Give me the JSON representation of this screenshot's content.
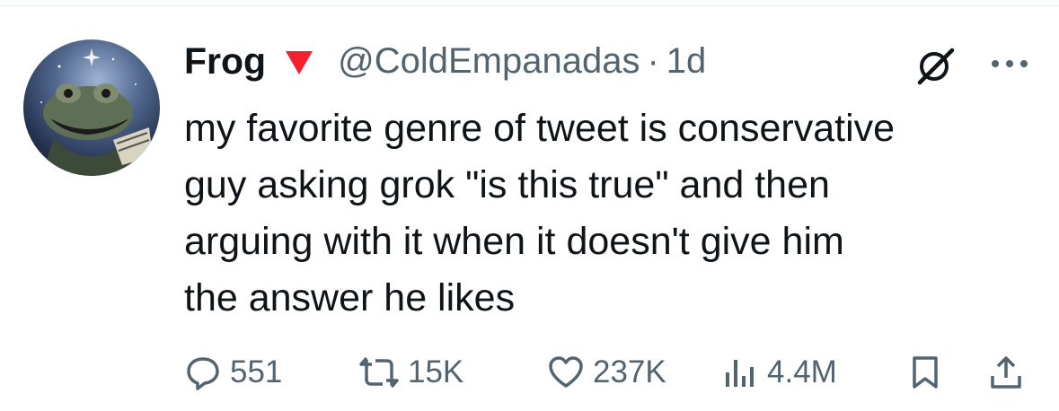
{
  "tweet": {
    "display_name": "Frog",
    "handle": "@ColdEmpanadas",
    "separator": "·",
    "timestamp": "1d",
    "text": "my favorite genre of tweet is conservative\nguy asking grok \"is this true\" and then\narguing with it when it doesn't give him\nthe answer he likes",
    "flag_color": "#f4212e",
    "avatar_icon": "frog-avatar",
    "metrics": {
      "replies": "551",
      "reposts": "15K",
      "likes": "237K",
      "views": "4.4M"
    }
  },
  "colors": {
    "text_primary": "#0f1419",
    "text_secondary": "#536471",
    "divider": "#e6ecf0"
  },
  "icons": [
    "grok-icon",
    "more-icon",
    "reply-icon",
    "repost-icon",
    "like-icon",
    "views-icon",
    "bookmark-icon",
    "share-icon"
  ]
}
